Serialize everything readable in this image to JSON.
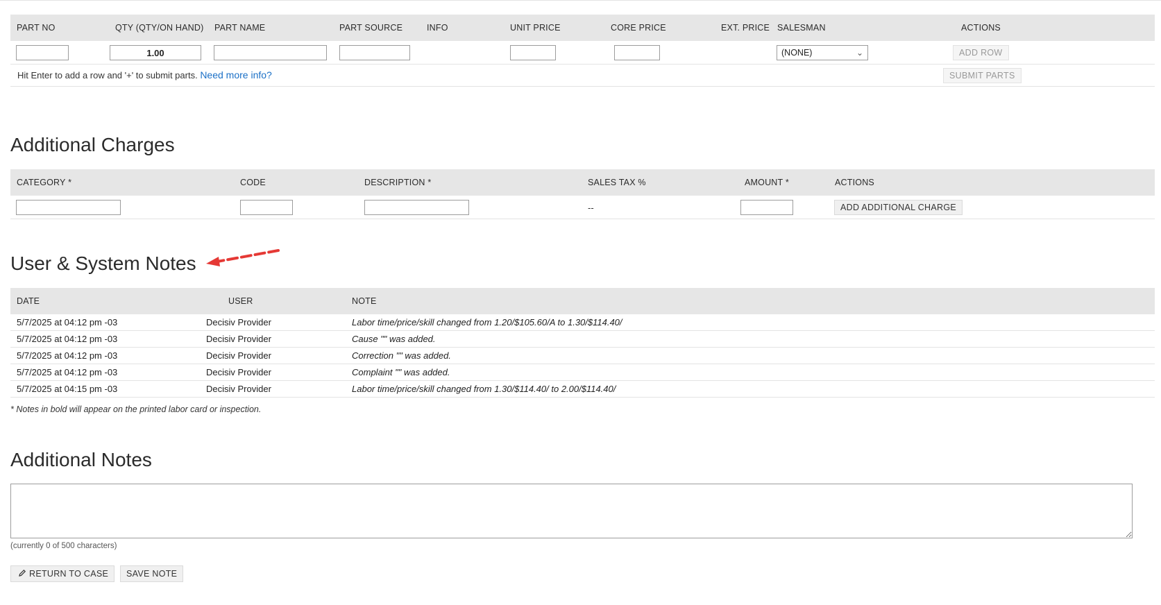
{
  "parts": {
    "columns": {
      "part_no": "PART NO",
      "qty": "QTY (QTY/ON HAND)",
      "part_name": "PART NAME",
      "part_source": "PART SOURCE",
      "info": "INFO",
      "unit_price": "UNIT PRICE",
      "core_price": "CORE PRICE",
      "ext_price": "EXT. PRICE",
      "salesman": "SALESMAN",
      "actions": "ACTIONS"
    },
    "qty_value": "1.00",
    "salesman_selected": "(NONE)",
    "add_row_label": "ADD ROW",
    "submit_parts_label": "SUBMIT PARTS",
    "hint": "Hit Enter to add a row and '+' to submit parts.",
    "hint_link": "Need more info?"
  },
  "charges": {
    "title": "Additional Charges",
    "columns": {
      "category": "CATEGORY",
      "code": "CODE",
      "description": "DESCRIPTION",
      "sales_tax": "SALES TAX %",
      "amount": "AMOUNT",
      "actions": "ACTIONS"
    },
    "required_mark": "*",
    "sales_tax_value": "--",
    "add_label": "ADD ADDITIONAL CHARGE"
  },
  "system_notes": {
    "title": "User & System Notes",
    "columns": {
      "date": "DATE",
      "user": "USER",
      "note": "NOTE"
    },
    "rows": [
      {
        "date": "5/7/2025 at 04:12 pm -03",
        "user": "Decisiv Provider",
        "note": "Labor time/price/skill changed from 1.20/$105.60/A to 1.30/$114.40/"
      },
      {
        "date": "5/7/2025 at 04:12 pm -03",
        "user": "Decisiv Provider",
        "note": "Cause \"\" was added."
      },
      {
        "date": "5/7/2025 at 04:12 pm -03",
        "user": "Decisiv Provider",
        "note": "Correction \"\" was added."
      },
      {
        "date": "5/7/2025 at 04:12 pm -03",
        "user": "Decisiv Provider",
        "note": "Complaint \"\" was added."
      },
      {
        "date": "5/7/2025 at 04:15 pm -03",
        "user": "Decisiv Provider",
        "note": "Labor time/price/skill changed from 1.30/$114.40/ to 2.00/$114.40/"
      }
    ],
    "footnote": "* Notes in bold will appear on the printed labor card or inspection."
  },
  "additional_notes": {
    "title": "Additional Notes",
    "value": "",
    "char_count": "(currently 0 of 500 characters)",
    "return_label": "RETURN TO CASE",
    "save_label": "SAVE NOTE"
  },
  "colors": {
    "arrow": "#e53935",
    "link": "#1a6fc6",
    "header_bg": "#e6e6e6"
  },
  "icons": {
    "return": "pencil-icon",
    "select": "chevron-down-icon",
    "annotation": "arrow-icon"
  }
}
